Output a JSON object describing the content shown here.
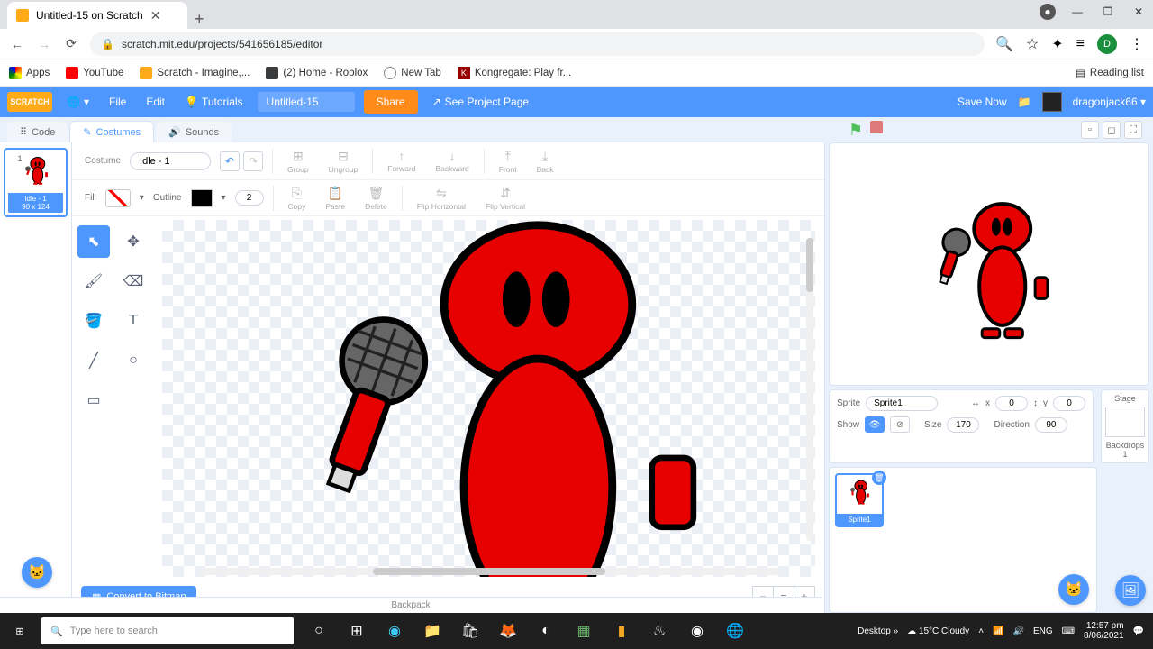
{
  "browser": {
    "tab_title": "Untitled-15 on Scratch",
    "new_tab": "+",
    "controls": {
      "incognito": "●",
      "min": "—",
      "max": "❐",
      "close": "✕"
    },
    "nav": {
      "back": "←",
      "forward": "→",
      "reload": "⟳",
      "lock": "🔒"
    },
    "url": "scratch.mit.edu/projects/541656185/editor",
    "addr_icons": {
      "zoom": "🔍",
      "star": "☆",
      "ext": "✦",
      "list": "≡",
      "avatar": "D",
      "menu": "⋮"
    },
    "bookmarks": {
      "apps": "Apps",
      "youtube": "YouTube",
      "scratch": "Scratch - Imagine,...",
      "roblox": "(2) Home - Roblox",
      "newtab": "New Tab",
      "kong": "Kongregate: Play fr...",
      "reading": "Reading list"
    }
  },
  "scratch_bar": {
    "logo": "SCRATCH",
    "globe": "🌐",
    "file": "File",
    "edit": "Edit",
    "tutorials": "Tutorials",
    "project_name": "Untitled-15",
    "share": "Share",
    "see_page": "See Project Page",
    "save": "Save Now",
    "folder": "📁",
    "username": "dragonjack66"
  },
  "tabs": {
    "code": "Code",
    "costumes": "Costumes",
    "sounds": "Sounds"
  },
  "flag": "⚑",
  "costume": {
    "number": "1",
    "name": "Idle - 1",
    "dims": "90 x 124",
    "label": "Costume",
    "undo": "↶",
    "redo": "↷",
    "group": "Group",
    "ungroup": "Ungroup",
    "forward": "Forward",
    "backward": "Backward",
    "front": "Front",
    "back": "Back",
    "fill": "Fill",
    "outline": "Outline",
    "outline_width": "2",
    "copy": "Copy",
    "paste": "Paste",
    "delete": "Delete",
    "fliph": "Flip Horizontal",
    "flipv": "Flip Vertical"
  },
  "tools": {
    "select": "⬉",
    "reshape": "✥",
    "brush": "🖌",
    "eraser": "⌫",
    "fill": "🪣",
    "text": "T",
    "line": "╱",
    "circle": "○",
    "rect": "▭"
  },
  "convert": "Convert to Bitmap",
  "zoom": {
    "out": "−",
    "reset": "=",
    "in": "+"
  },
  "backpack": "Backpack",
  "sprite_info": {
    "sprite_label": "Sprite",
    "sprite_name": "Sprite1",
    "x_label": "x",
    "x": "0",
    "y_label": "y",
    "y": "0",
    "show_label": "Show",
    "size_label": "Size",
    "size": "170",
    "dir_label": "Direction",
    "dir": "90"
  },
  "sprite_item": {
    "name": "Sprite1"
  },
  "stage": {
    "label": "Stage",
    "backdrops_label": "Backdrops",
    "count": "1"
  },
  "taskbar": {
    "search": "Type here to search",
    "desktop": "Desktop",
    "chev": "»",
    "weather_temp": "15°C",
    "weather_label": "Cloudy",
    "lang": "ENG",
    "time": "12:57 pm",
    "date": "8/06/2021"
  }
}
